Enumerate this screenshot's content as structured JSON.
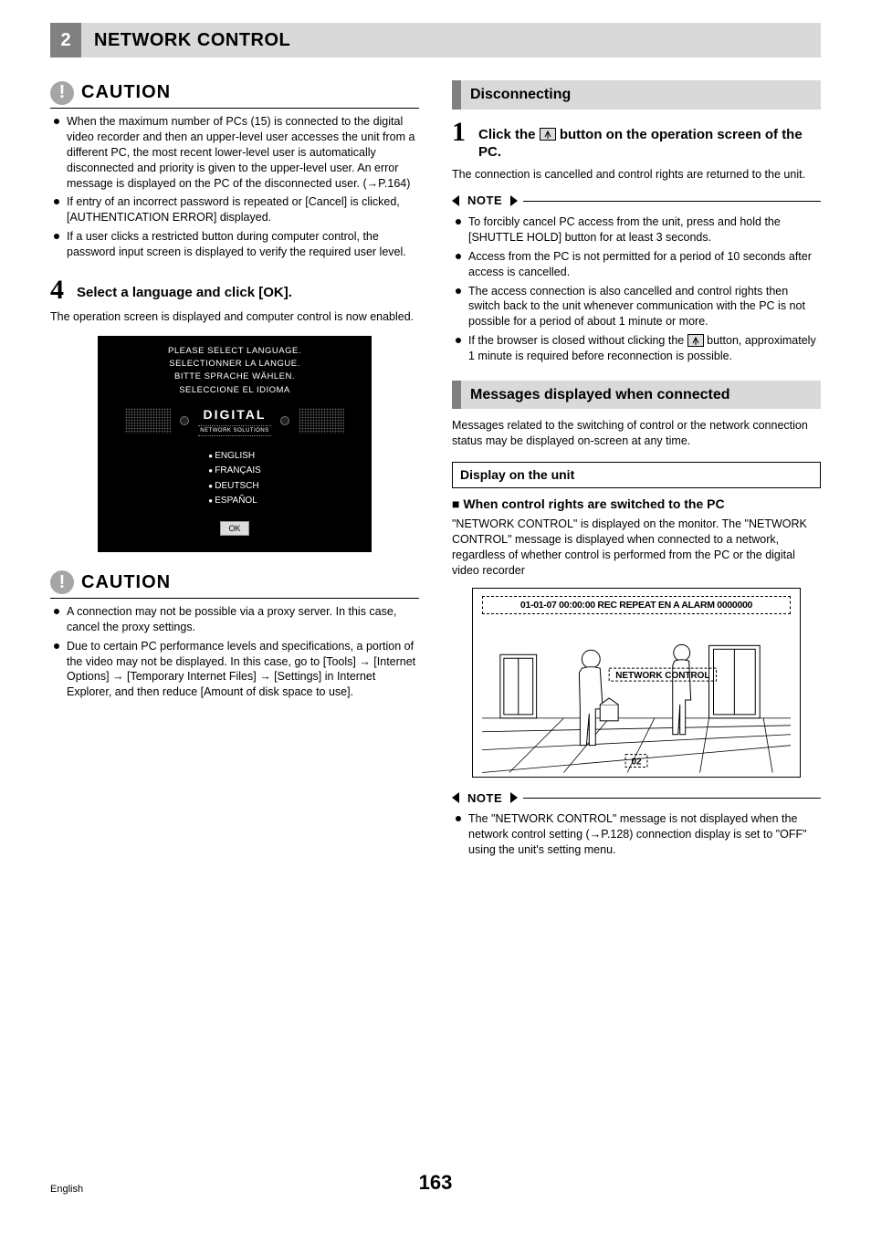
{
  "header": {
    "section_num": "2",
    "title": "NETWORK CONTROL"
  },
  "left": {
    "caution1_label": "CAUTION",
    "caution1_items": [
      "When the maximum number of PCs (15) is connected to the digital video recorder and then an upper-level user accesses the unit from a different PC, the most recent lower-level user is automatically disconnected and priority is given to the upper-level user.\nAn error message is displayed on the PC of the disconnected user. (→P.164)",
      "If entry of an incorrect password is repeated or [Cancel] is clicked, [AUTHENTICATION ERROR] displayed.",
      "If a user clicks a restricted button during computer control, the password input screen is displayed to verify the required user level."
    ],
    "step4_num": "4",
    "step4_title": "Select a language and click [OK].",
    "step4_body": "The operation screen is displayed and computer control is now enabled.",
    "lang_dialog": {
      "lines": [
        "PLEASE SELECT LANGUAGE.",
        "SELECTIONNER LA LANGUE.",
        "BITTE SPRACHE WÄHLEN.",
        "SELECCIONE EL IDIOMA"
      ],
      "logo": "DIGITAL",
      "logo_sub": "NETWORK SOLUTIONS",
      "langs": [
        "ENGLISH",
        "FRANÇAIS",
        "DEUTSCH",
        "ESPAÑOL"
      ],
      "ok": "OK"
    },
    "caution2_label": "CAUTION",
    "caution2_items": [
      "A connection may not be possible via a proxy server. In this case, cancel the proxy settings.",
      "Due to certain PC performance levels and specifications, a portion of the video may not be displayed. In this case, go to [Tools] → [Internet Options] → [Temporary Internet Files] → [Settings] in Internet Explorer, and then reduce [Amount of disk space to use]."
    ]
  },
  "right": {
    "disconnecting_title": "Disconnecting",
    "step1_num": "1",
    "step1_pre": "Click the ",
    "step1_post": " button on the operation screen of the PC.",
    "step1_body": "The connection is cancelled and control rights are returned to the unit.",
    "note1_label": "NOTE",
    "note1_items": [
      "To forcibly cancel PC access from the unit, press and hold the [SHUTTLE HOLD] button for at least 3 seconds.",
      "Access from the PC is not permitted for a period of 10 seconds after access is cancelled.",
      "The access connection is also cancelled and control rights then switch back to the unit whenever communication with the PC is not possible for a period of about 1 minute or more.",
      "If the browser is closed without clicking the [icon] button, approximately 1 minute is required before reconnection is possible."
    ],
    "messages_title": "Messages displayed when connected",
    "messages_intro": "Messages related to the switching of control or the network connection status may be displayed on-screen at any time.",
    "display_box": "Display on the unit",
    "switched_head": "When control rights are switched to the PC",
    "switched_body": "\"NETWORK CONTROL\" is displayed on the monitor. The \"NETWORK CONTROL\" message is displayed when connected to a network, regardless of whether control is performed from the PC or the digital video recorder",
    "osd": "01-01-07 00:00:00 REC REPEAT EN A ALARM 0000000",
    "osd_center": "NETWORK CONTROL",
    "osd_cam": "02",
    "note2_label": "NOTE",
    "note2_items": [
      "The \"NETWORK CONTROL\" message is not displayed when the network control setting  (→P.128) connection display is set to \"OFF\" using the unit's setting menu."
    ]
  },
  "footer": {
    "lang": "English",
    "page": "163"
  }
}
